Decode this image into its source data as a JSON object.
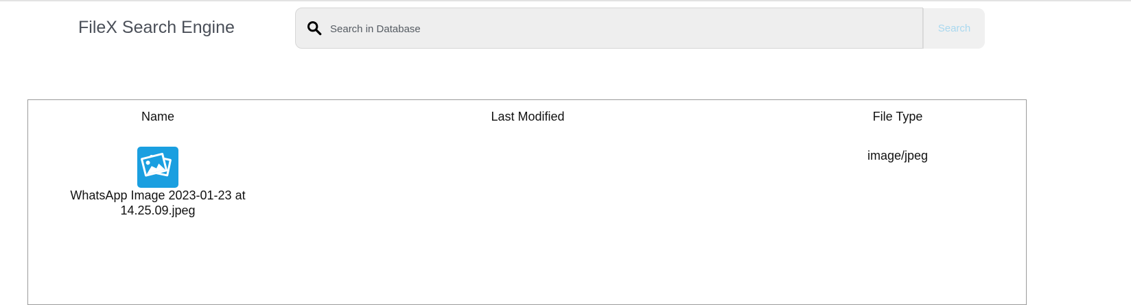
{
  "header": {
    "brand": "FileX Search Engine"
  },
  "search": {
    "placeholder": "Search in Database",
    "value": "",
    "button_label": "Search",
    "icon": "search-icon"
  },
  "table": {
    "columns": [
      "Name",
      "Last Modified",
      "File Type"
    ],
    "rows": [
      {
        "icon": "image-file-icon",
        "name": "WhatsApp Image 2023-01-23 at 14.25.09.jpeg",
        "last_modified": "",
        "file_type": "image/jpeg"
      }
    ]
  },
  "colors": {
    "brand_text": "#4a4f58",
    "search_bg": "#eeeeee",
    "search_button_text": "#a9d8ef",
    "icon_blue": "#1a9fe0"
  }
}
